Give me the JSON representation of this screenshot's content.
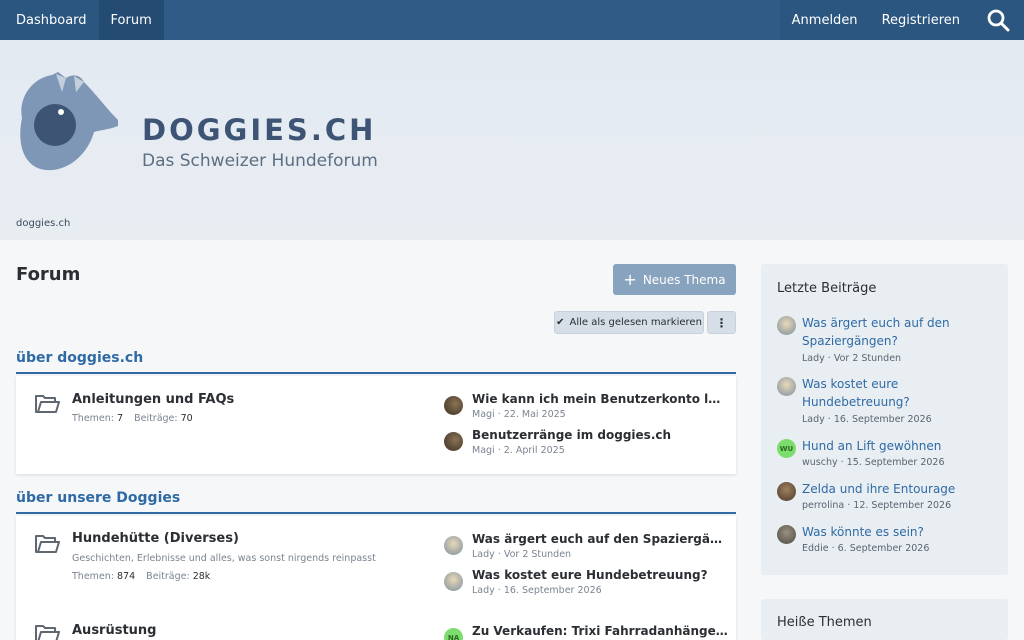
{
  "nav": {
    "dashboard": "Dashboard",
    "forum": "Forum",
    "login": "Anmelden",
    "register": "Registrieren"
  },
  "brand": {
    "title": "DOGGIES.CH",
    "subtitle": "Das Schweizer Hundeforum"
  },
  "breadcrumb": "doggies.ch",
  "page": {
    "title": "Forum",
    "new_thread": "Neues Thema",
    "mark_read": "Alle als gelesen markieren",
    "more": "⋮"
  },
  "categories": [
    {
      "title": "über doggies.ch",
      "forums": [
        {
          "name": "Anleitungen und FAQs",
          "description": "",
          "threads_label": "Themen:",
          "threads": "7",
          "posts_label": "Beiträge:",
          "posts": "70",
          "latest": [
            {
              "title": "Wie kann ich mein Benutzerkonto lösch...",
              "meta": "Magi · 22. Mai 2025"
            },
            {
              "title": "Benutzerränge im doggies.ch",
              "meta": "Magi · 2. April 2025"
            }
          ]
        }
      ]
    },
    {
      "title": "über unsere Doggies",
      "forums": [
        {
          "name": "Hundehütte (Diverses)",
          "description": "Geschichten, Erlebnisse und alles, was sonst nirgends reinpasst",
          "threads_label": "Themen:",
          "threads": "874",
          "posts_label": "Beiträge:",
          "posts": "28k",
          "latest": [
            {
              "title": "Was ärgert euch auf den Spaziergängen?",
              "meta": "Lady · Vor 2 Stunden"
            },
            {
              "title": "Was kostet eure Hundebetreuung?",
              "meta": "Lady · 16. September 2026"
            }
          ]
        },
        {
          "name": "Ausrüstung",
          "latest": [
            {
              "title": "Zu Verkaufen: Trixi Fahrradanhänger au...",
              "avatar_initials": "NA"
            }
          ]
        }
      ]
    }
  ],
  "sidebar": {
    "latest_title": "Letzte Beiträge",
    "latest": [
      {
        "title": "Was ärgert euch auf den Spaziergängen?",
        "meta": "Lady · Vor 2 Stunden"
      },
      {
        "title": "Was kostet eure Hundebetreuung?",
        "meta": "Lady · 16. September 2026"
      },
      {
        "title": "Hund an Lift gewöhnen",
        "meta": "wuschy · 15. September 2026",
        "avatar_initials": "WU"
      },
      {
        "title": "Zelda und ihre Entourage",
        "meta": "perrolina · 12. September 2026"
      },
      {
        "title": "Was könnte es sein?",
        "meta": "Eddie · 6. September 2026"
      }
    ],
    "hot_title": "Heiße Themen"
  },
  "colors": {
    "nav_bg": "#2f5b86",
    "accent": "#2f6aa5",
    "button_bg": "#88a3bd",
    "avatar_green": "#7ddc6e"
  }
}
